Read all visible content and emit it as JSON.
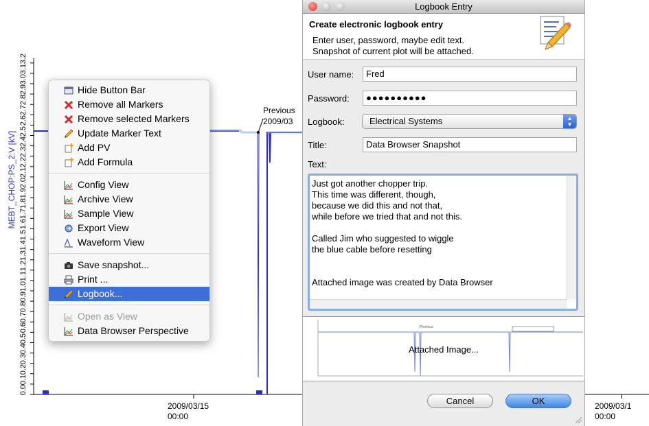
{
  "plot": {
    "y_axis_label": "MEBT_CHOP:PS_2:V [kV]",
    "y_ticks": [
      "0.0",
      "0.1",
      "0.2",
      "0.3",
      "0.4",
      "0.5",
      "0.6",
      "0.7",
      "0.8",
      "0.9",
      "1.0",
      "1.1",
      "1.2",
      "1.3",
      "1.4",
      "1.5",
      "1.6",
      "1.7",
      "1.8",
      "1.9",
      "2.0",
      "2.1",
      "2.2",
      "2.3",
      "2.4",
      "2.5",
      "2.6",
      "2.7",
      "2.8",
      "2.9",
      "3.0",
      "3.1",
      "3.2"
    ],
    "x_ticks": [
      {
        "date": "2009/03/15",
        "time": "00:00"
      },
      {
        "date": "2009/03/1",
        "time": "00:00"
      }
    ],
    "marker": {
      "line1": "Previous",
      "line2": "2009/03"
    },
    "colors": {
      "trace": "#2c2cd6",
      "label": "#3a3acc"
    }
  },
  "context_menu": {
    "items": [
      {
        "label": "Hide Button Bar",
        "icon": "button-bar-icon",
        "state": "normal"
      },
      {
        "label": "Remove all Markers",
        "icon": "red-x-icon",
        "state": "normal"
      },
      {
        "label": "Remove selected Markers",
        "icon": "red-x-icon",
        "state": "normal"
      },
      {
        "label": "Update Marker Text",
        "icon": "pencil-icon",
        "state": "normal"
      },
      {
        "label": "Add PV",
        "icon": "add-icon",
        "state": "normal"
      },
      {
        "label": "Add Formula",
        "icon": "add-icon",
        "state": "normal"
      },
      {
        "label": "Config View",
        "icon": "chart-icon",
        "state": "normal"
      },
      {
        "label": "Archive View",
        "icon": "chart-icon",
        "state": "normal"
      },
      {
        "label": "Sample View",
        "icon": "chart-icon",
        "state": "normal"
      },
      {
        "label": "Export View",
        "icon": "export-icon",
        "state": "normal"
      },
      {
        "label": "Waveform View",
        "icon": "waveform-icon",
        "state": "normal"
      },
      {
        "label": "Save snapshot...",
        "icon": "camera-icon",
        "state": "normal"
      },
      {
        "label": "Print ...",
        "icon": "printer-icon",
        "state": "normal"
      },
      {
        "label": "Logbook...",
        "icon": "pencil-icon",
        "state": "selected"
      },
      {
        "label": "Open as View",
        "icon": "chart-icon",
        "state": "disabled"
      },
      {
        "label": "Data Browser Perspective",
        "icon": "chart-icon",
        "state": "normal"
      }
    ]
  },
  "dialog": {
    "title": "Logbook Entry",
    "header_title": "Create electronic logbook entry",
    "header_line1": "Enter user, password, maybe edit text.",
    "header_line2": "Snapshot of current plot will be attached.",
    "user_label": "User name:",
    "user_value": "Fred",
    "password_label": "Password:",
    "password_value": "●●●●●●●●●●",
    "logbook_label": "Logbook:",
    "logbook_value": "Electrical Systems",
    "title_label": "Title:",
    "title_value": "Data Browser Snapshot",
    "text_label": "Text:",
    "text_value": "Just got another chopper trip.\nThis time was different, though,\nbecause we did this and not that,\nwhile before we tried that and not this.\n\nCalled Jim who suggested to wiggle\nthe blue cable before resetting\n\n\nAttached image was created by Data Browser",
    "attached_label": "Attached Image...",
    "cancel_label": "Cancel",
    "ok_label": "OK"
  }
}
